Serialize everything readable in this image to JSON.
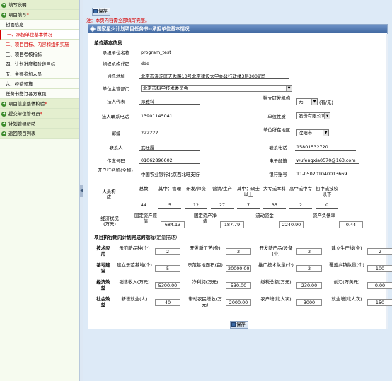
{
  "sidebar": [
    {
      "label": "填写说明",
      "type": "main"
    },
    {
      "label": "项目填写",
      "type": "main",
      "mark": "*"
    },
    {
      "label": "封面信息",
      "type": "sub"
    },
    {
      "label": "一、承担单位基本情况",
      "type": "sub",
      "active": true
    },
    {
      "label": "二、项目目标、内容和组织实施",
      "type": "sub",
      "active": true
    },
    {
      "label": "三、项目考核指标",
      "type": "sub"
    },
    {
      "label": "四、计划进度和阶段目标",
      "type": "sub"
    },
    {
      "label": "五、主要参加人员",
      "type": "sub"
    },
    {
      "label": "六、经费预算",
      "type": "sub"
    },
    {
      "label": "任务书签订各方意见",
      "type": "sub"
    },
    {
      "label": "项目信息整体校验",
      "type": "main",
      "mark": "*"
    },
    {
      "label": "提交单位管理员",
      "type": "main",
      "mark": "*"
    },
    {
      "label": "计划管理帮助",
      "type": "main"
    },
    {
      "label": "返回项目列表",
      "type": "main"
    }
  ],
  "toolbar": {
    "save_label": "保存"
  },
  "notice": "注：本页内容需全部填写完整。",
  "panel_title": "国家星火计划项目任务书--承担单位基本情况",
  "basic": {
    "section_title": "单位基本信息",
    "unit_name_label": "承担单位名称",
    "unit_name": "program_test",
    "org_code_label": "组织机构代码",
    "org_code": "ddd",
    "address_label": "通讯地址",
    "address": "北京市海淀区天秀路10号北京建设大学办公行政楼3层3009室",
    "dept_label": "单位主管部门",
    "dept": "北京市科学技术委员会",
    "legal_rep_label": "法人代表",
    "legal_rep": "邓雅科",
    "independent_label": "独立研发机构",
    "independent": "无",
    "independent_hint": "(有/无)",
    "legal_phone_label": "法人联系电话",
    "legal_phone": "13901145041",
    "unit_type_label": "单位性质",
    "unit_type": "股份有限公司",
    "postcode_label": "邮编",
    "postcode": "222222",
    "location_label": "单位所在地区",
    "location": "沈阳市",
    "contact_label": "联系人",
    "contact": "武旺霞",
    "contact_phone_label": "联系电话",
    "contact_phone": "15801532720",
    "fax_label": "传真号码",
    "fax": "01062896602",
    "email_label": "电子邮箱",
    "email": "wufengxia0570@163.com",
    "bank_label": "开户行名称(全称)",
    "bank": "中国农业银行北京西北旺支行",
    "account_label": "银行账号",
    "account": "11-050201040013669"
  },
  "staff": {
    "row_label": "人员构成",
    "headers": [
      "总数",
      "其中：管理",
      "研发/师资",
      "营销/生产",
      "其中：硕士以上",
      "大专或本科",
      "高中或中专",
      "初中或技校以下"
    ],
    "values": [
      "44",
      "5",
      "12",
      "27",
      "7",
      "35",
      "2",
      "0"
    ]
  },
  "finance": {
    "row_label": "经济状况(万元)",
    "items": [
      {
        "label": "固定资产原值",
        "value": "684.13"
      },
      {
        "label": "固定资产净值",
        "value": "187.79"
      },
      {
        "label": "流动资金",
        "value": "2240.90"
      },
      {
        "label": "资产负债率",
        "value": "0.44"
      }
    ]
  },
  "targets": {
    "section_title": "项目执行期内计划完成的指标",
    "section_hint": "(定量描述)",
    "rows": [
      {
        "category": "技术应用",
        "items": [
          {
            "label": "示范新品种(个)",
            "value": "2"
          },
          {
            "label": "开发新工艺(条)",
            "value": "2"
          },
          {
            "label": "开发新产品/设备(个)",
            "value": "2"
          },
          {
            "label": "建立生产线(条)",
            "value": "2"
          }
        ]
      },
      {
        "category": "基地建设",
        "items": [
          {
            "label": "建立示范基地(个)",
            "value": "5"
          },
          {
            "label": "示范基地面积(亩)",
            "value": "20000.00"
          },
          {
            "label": "推广技术数量(个)",
            "value": "2"
          },
          {
            "label": "覆盖乡镇数量(个)",
            "value": "100"
          }
        ]
      },
      {
        "category": "经济效益",
        "items": [
          {
            "label": "销售收入(万元)",
            "value": "5300.00"
          },
          {
            "label": "净利润(万元)",
            "value": "530.00"
          },
          {
            "label": "缴税总额(万元)",
            "value": "230.00"
          },
          {
            "label": "创汇(万美元)",
            "value": "0.00"
          }
        ]
      },
      {
        "category": "社会效益",
        "items": [
          {
            "label": "新增就业(人)",
            "value": "40"
          },
          {
            "label": "带动农民增收(万元)",
            "value": "2000.00"
          },
          {
            "label": "农户培训(人次)",
            "value": "3000"
          },
          {
            "label": "就业培训(人次)",
            "value": "150"
          }
        ]
      }
    ]
  },
  "colors": {
    "accent": "#3f679f",
    "required": "#d60000",
    "sidebar_bg": "#f6fbef"
  }
}
